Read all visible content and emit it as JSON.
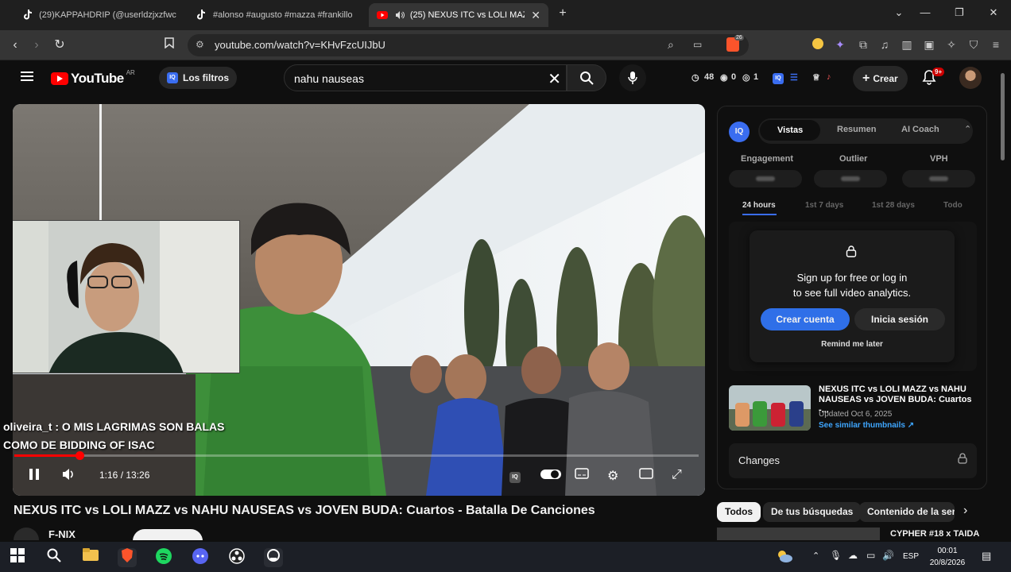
{
  "browser": {
    "tabs": [
      {
        "label": "(29)KAPPAHDRIP (@userldzjxzfwcf) |",
        "icon": "tiktok-icon",
        "active": false
      },
      {
        "label": "#alonso #augusto #mazza #frankillo",
        "icon": "tiktok-icon",
        "active": false
      },
      {
        "label": "(25) NEXUS ITC vs LOLI MAZZ",
        "icon": "youtube-icon",
        "active": true
      }
    ],
    "new_tab": "+",
    "url": "youtube.com/watch?v=KHvFzcUIJbU",
    "brave_badge": "26"
  },
  "youtube": {
    "logo_text": "YouTube",
    "region": "AR",
    "filters_label": "Los filtros",
    "search_query": "nahu nauseas",
    "stats": {
      "views": "48",
      "eye": "0",
      "other": "1"
    },
    "create_label": "Crear",
    "notif_count": "9+"
  },
  "player": {
    "chat_line1": "oliveira_t : O MIS LAGRIMAS SON BALAS",
    "chat_line2": "COMO DE BIDDING OF ISAC",
    "time": "1:16 / 13:26",
    "progress_fraction": 0.095
  },
  "video": {
    "title": "NEXUS ITC vs LOLI MAZZ vs NAHU NAUSEAS vs JOVEN BUDA: Cuartos - Batalla De Canciones",
    "channel": "F-NIX"
  },
  "iq_panel": {
    "logo": "IQ",
    "tabs": [
      "Vistas",
      "Resumen",
      "AI Coach"
    ],
    "metrics": [
      "Engagement",
      "Outlier",
      "VPH"
    ],
    "ranges": [
      "24 hours",
      "1st 7 days",
      "1st 28 days",
      "Todo"
    ],
    "lock_line1": "Sign up for free or log in",
    "lock_line2": "to see full video analytics.",
    "create_account": "Crear cuenta",
    "login": "Inicia sesión",
    "remind": "Remind me later",
    "related_title": "NEXUS ITC vs LOLI MAZZ vs NAHU NAUSEAS vs JOVEN BUDA: Cuartos -...",
    "related_date": "Updated Oct 6, 2025",
    "related_link": "See similar thumbnails ↗",
    "changes": "Changes"
  },
  "chips": [
    "Todos",
    "De tus búsquedas",
    "Contenido de la seri"
  ],
  "next_related": "CYPHER #18 x TAIDA",
  "taskbar": {
    "lang": "ESP",
    "time": "00:01",
    "date": "20/8/2026"
  }
}
